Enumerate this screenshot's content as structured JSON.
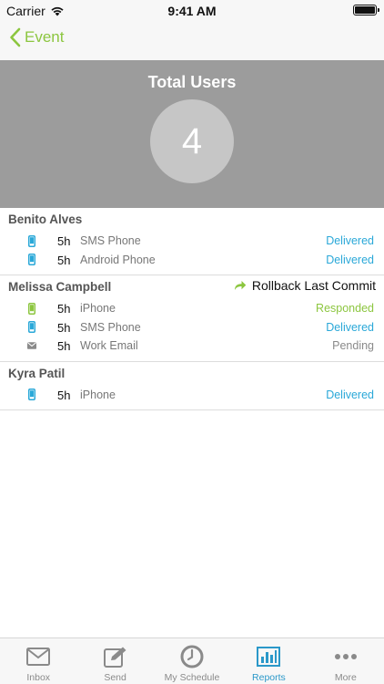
{
  "status_bar": {
    "carrier": "Carrier",
    "time": "9:41 AM"
  },
  "nav": {
    "back_label": "Event"
  },
  "header": {
    "title": "Total Users",
    "count": "4"
  },
  "colors": {
    "accent_green": "#8cc63f",
    "delivered_blue": "#2aa8d8",
    "responded_green": "#8cc63f",
    "pending_gray": "#8a8a8a",
    "tab_active": "#2a98c9"
  },
  "users": [
    {
      "name": "Benito Alves",
      "action": "",
      "devices": [
        {
          "icon": "phone-icon",
          "time": "5h",
          "name": "SMS Phone",
          "status": "Delivered",
          "status_type": "delivered"
        },
        {
          "icon": "phone-icon",
          "time": "5h",
          "name": "Android Phone",
          "status": "Delivered",
          "status_type": "delivered"
        }
      ]
    },
    {
      "name": "Melissa Campbell",
      "action": "Rollback Last Commit",
      "devices": [
        {
          "icon": "phone-icon",
          "time": "5h",
          "name": "iPhone",
          "status": "Responded",
          "status_type": "responded"
        },
        {
          "icon": "phone-icon",
          "time": "5h",
          "name": "SMS Phone",
          "status": "Delivered",
          "status_type": "delivered"
        },
        {
          "icon": "envelope-icon",
          "time": "5h",
          "name": "Work Email",
          "status": "Pending",
          "status_type": "pending"
        }
      ]
    },
    {
      "name": "Kyra Patil",
      "action": "",
      "devices": [
        {
          "icon": "phone-icon",
          "time": "5h",
          "name": "iPhone",
          "status": "Delivered",
          "status_type": "delivered"
        }
      ]
    }
  ],
  "tabs": [
    {
      "label": "Inbox",
      "icon": "inbox-icon",
      "active": false
    },
    {
      "label": "Send",
      "icon": "compose-icon",
      "active": false
    },
    {
      "label": "My Schedule",
      "icon": "clock-icon",
      "active": false
    },
    {
      "label": "Reports",
      "icon": "bar-chart-icon",
      "active": true
    },
    {
      "label": "More",
      "icon": "more-icon",
      "active": false
    }
  ]
}
